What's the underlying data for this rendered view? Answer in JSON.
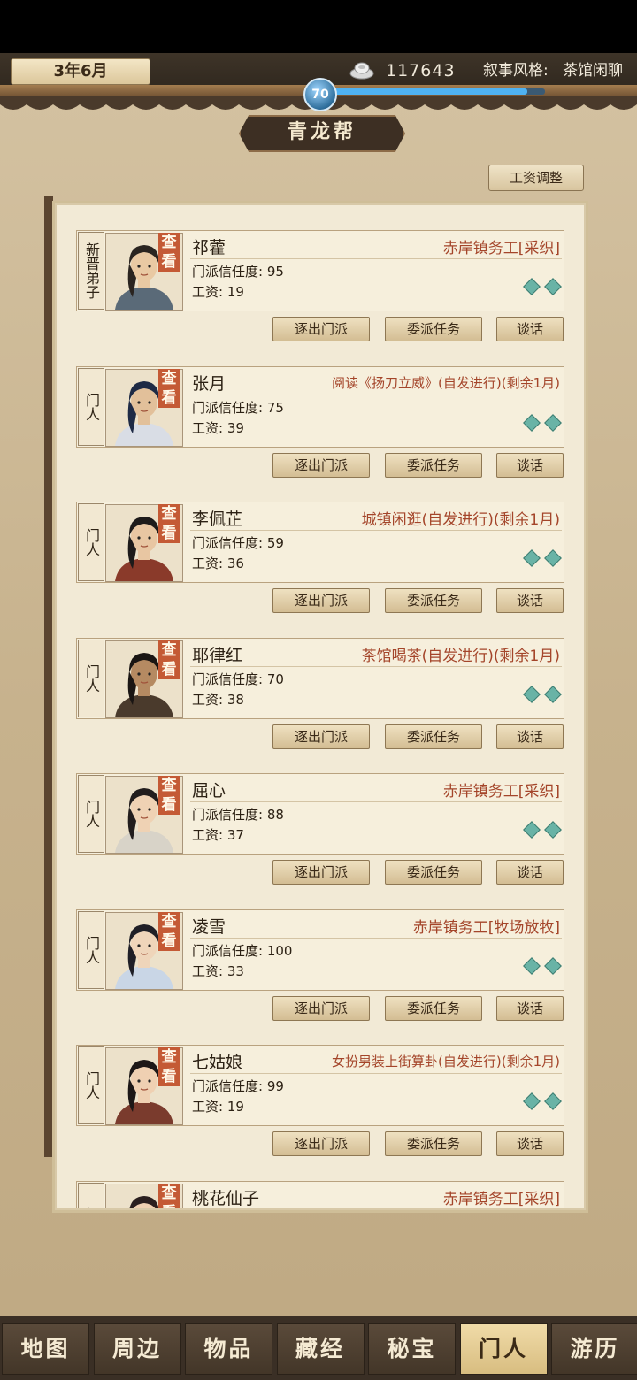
{
  "header": {
    "date": "3年6月",
    "silver": "117643",
    "narrative_label": "叙事风格:",
    "narrative_value": "茶馆闲聊",
    "level": "70",
    "xp_fraction": 0.92
  },
  "sect": {
    "name": "青龙帮"
  },
  "wage_adjust_label": "工资调整",
  "labels": {
    "trust": "门派信任度:",
    "wage": "工资:",
    "view": "查看"
  },
  "actions": {
    "expel": "逐出门派",
    "assign": "委派任务",
    "talk": "谈话"
  },
  "members": [
    {
      "role": "新晋弟子",
      "name": "祁藿",
      "status": "赤岸镇务工[采织]",
      "trust": "95",
      "wage": "19",
      "hair": "#2a2420",
      "skin": "#e9c9a3",
      "cloth": "#5a6a78"
    },
    {
      "role": "门人",
      "name": "张月",
      "status": "阅读《扬刀立威》(自发进行)(剩余1月)",
      "trust": "75",
      "wage": "39",
      "hair": "#1e2a45",
      "skin": "#e2c09a",
      "cloth": "#d9dde5"
    },
    {
      "role": "门人",
      "name": "李佩芷",
      "status": "城镇闲逛(自发进行)(剩余1月)",
      "trust": "59",
      "wage": "36",
      "hair": "#1d1a1a",
      "skin": "#e8c6a2",
      "cloth": "#8a3a2a"
    },
    {
      "role": "门人",
      "name": "耶律红",
      "status": "茶馆喝茶(自发进行)(剩余1月)",
      "trust": "70",
      "wage": "38",
      "hair": "#1a1513",
      "skin": "#b58a62",
      "cloth": "#4a3a2c"
    },
    {
      "role": "门人",
      "name": "屈心",
      "status": "赤岸镇务工[采织]",
      "trust": "88",
      "wage": "37",
      "hair": "#221d1d",
      "skin": "#efd2b4",
      "cloth": "#d8d3c8"
    },
    {
      "role": "门人",
      "name": "凌雪",
      "status": "赤岸镇务工[牧场放牧]",
      "trust": "100",
      "wage": "33",
      "hair": "#1f1f27",
      "skin": "#efd5ba",
      "cloth": "#c9d6e6"
    },
    {
      "role": "门人",
      "name": "七姑娘",
      "status": "女扮男装上街算卦(自发进行)(剩余1月)",
      "trust": "99",
      "wage": "19",
      "hair": "#1c1717",
      "skin": "#efd0b2",
      "cloth": "#7a3b2d"
    },
    {
      "role": "门人",
      "name": "桃花仙子",
      "status": "赤岸镇务工[采织]",
      "trust": "",
      "wage": "",
      "hair": "#2a1f1f",
      "skin": "#efd0b2",
      "cloth": "#c66d7a"
    }
  ],
  "nav": [
    "地图",
    "周边",
    "物品",
    "藏经",
    "秘宝",
    "门人",
    "游历"
  ],
  "nav_active": 5
}
